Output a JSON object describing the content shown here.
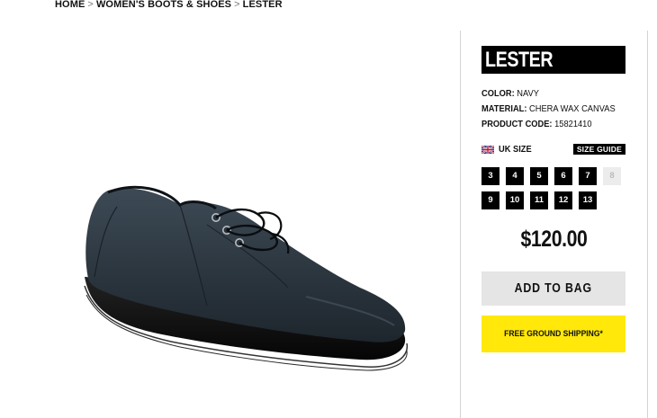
{
  "breadcrumb": {
    "items": [
      "HOME",
      "WOMEN'S BOOTS & SHOES",
      "LESTER"
    ],
    "separator": ">"
  },
  "product": {
    "title": "LESTER",
    "color_label": "COLOR:",
    "color_value": "NAVY",
    "material_label": "MATERIAL:",
    "material_value": "CHERA WAX CANVAS",
    "code_label": "PRODUCT CODE:",
    "code_value": "15821410",
    "image_icon": "navy-canvas-lace-shoe"
  },
  "sizing": {
    "flag_icon": "uk-flag-icon",
    "label": "UK SIZE",
    "guide_label": "SIZE GUIDE",
    "sizes": [
      {
        "label": "3",
        "available": true
      },
      {
        "label": "4",
        "available": true
      },
      {
        "label": "5",
        "available": true
      },
      {
        "label": "6",
        "available": true
      },
      {
        "label": "7",
        "available": true
      },
      {
        "label": "8",
        "available": false
      },
      {
        "label": "9",
        "available": true
      },
      {
        "label": "10",
        "available": true
      },
      {
        "label": "11",
        "available": true
      },
      {
        "label": "12",
        "available": true
      },
      {
        "label": "13",
        "available": true
      }
    ]
  },
  "price": "$120.00",
  "add_to_bag_label": "ADD TO BAG",
  "shipping_label": "FREE GROUND SHIPPING*",
  "colors": {
    "accent_yellow": "#ffe80a",
    "button_gray": "#e5e5e5",
    "size_black": "#000000",
    "size_unavailable": "#ececec"
  }
}
